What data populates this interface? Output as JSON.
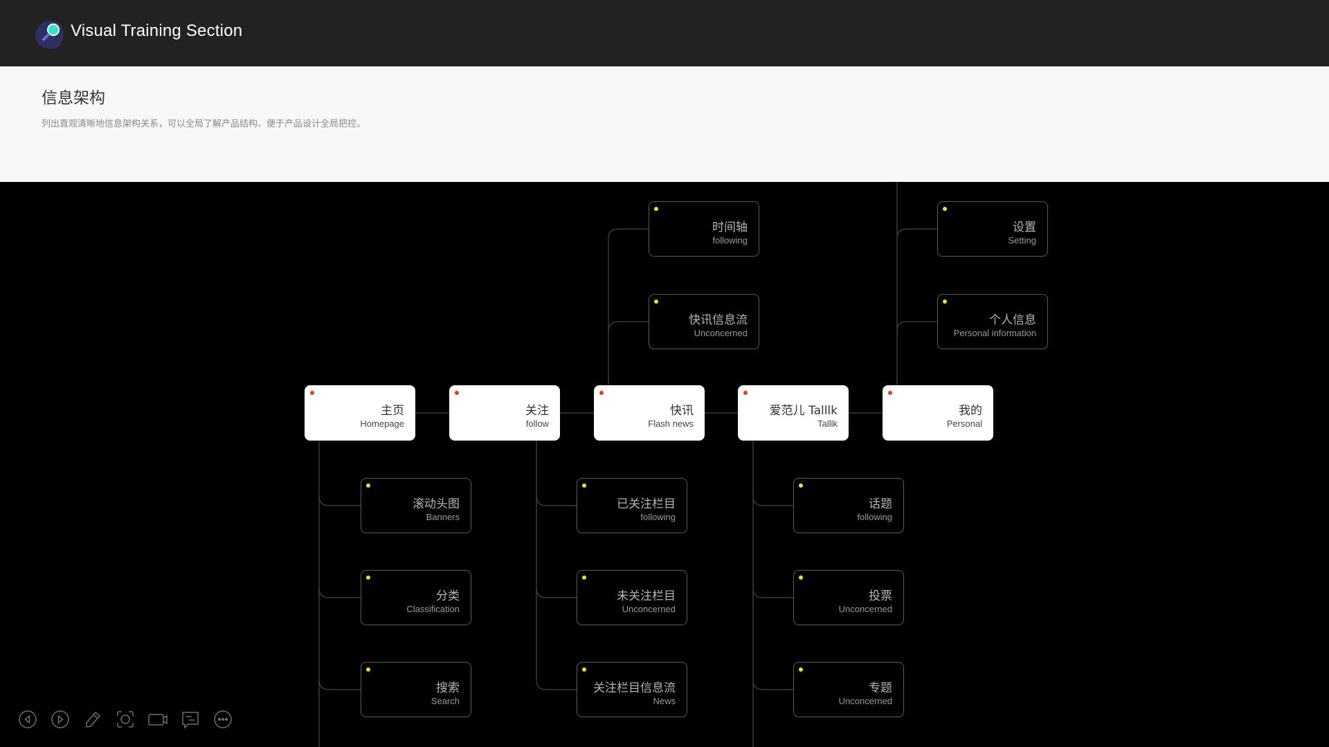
{
  "header": {
    "title": "Visual Training Section",
    "logo_icon": "magnifier-logo-icon"
  },
  "intro": {
    "title": "信息架构",
    "subtitle": "列出直观清晰地信息架构关系，可以全局了解产品结构、便于产品设计全局把控。"
  },
  "colors": {
    "main_dot": "#f03a17",
    "child_dot": "#ffe100",
    "header_bg": "#222222",
    "canvas_bg": "#000000"
  },
  "main_nodes": [
    {
      "zh": "主页",
      "en": "Homepage"
    },
    {
      "zh": "关注",
      "en": "follow"
    },
    {
      "zh": "快讯",
      "en": "Flash news"
    },
    {
      "zh": "爱范儿 Talllk",
      "en": "Talllk"
    },
    {
      "zh": "我的",
      "en": "Personal"
    }
  ],
  "children": {
    "homepage": [
      {
        "zh": "滚动头图",
        "en": "Banners"
      },
      {
        "zh": "分类",
        "en": "Classification"
      },
      {
        "zh": "搜索",
        "en": "Search"
      }
    ],
    "follow": [
      {
        "zh": "已关注栏目",
        "en": "following"
      },
      {
        "zh": "未关注栏目",
        "en": "Unconcerned"
      },
      {
        "zh": "关注栏目信息流",
        "en": "News"
      }
    ],
    "flash_news": [
      {
        "zh": "时间轴",
        "en": "following"
      },
      {
        "zh": "快讯信息流",
        "en": "Unconcerned"
      }
    ],
    "talllk": [
      {
        "zh": "话题",
        "en": "following"
      },
      {
        "zh": "投票",
        "en": "Unconcerned"
      },
      {
        "zh": "专题",
        "en": "Unconcerned"
      }
    ],
    "personal": [
      {
        "zh": "设置",
        "en": "Setting"
      },
      {
        "zh": "个人信息",
        "en": "Personal information"
      }
    ]
  },
  "toolbar": {
    "items": [
      "previous-icon",
      "next-icon",
      "pen-icon",
      "screenshot-icon",
      "camera-icon",
      "comment-icon",
      "more-icon"
    ]
  }
}
